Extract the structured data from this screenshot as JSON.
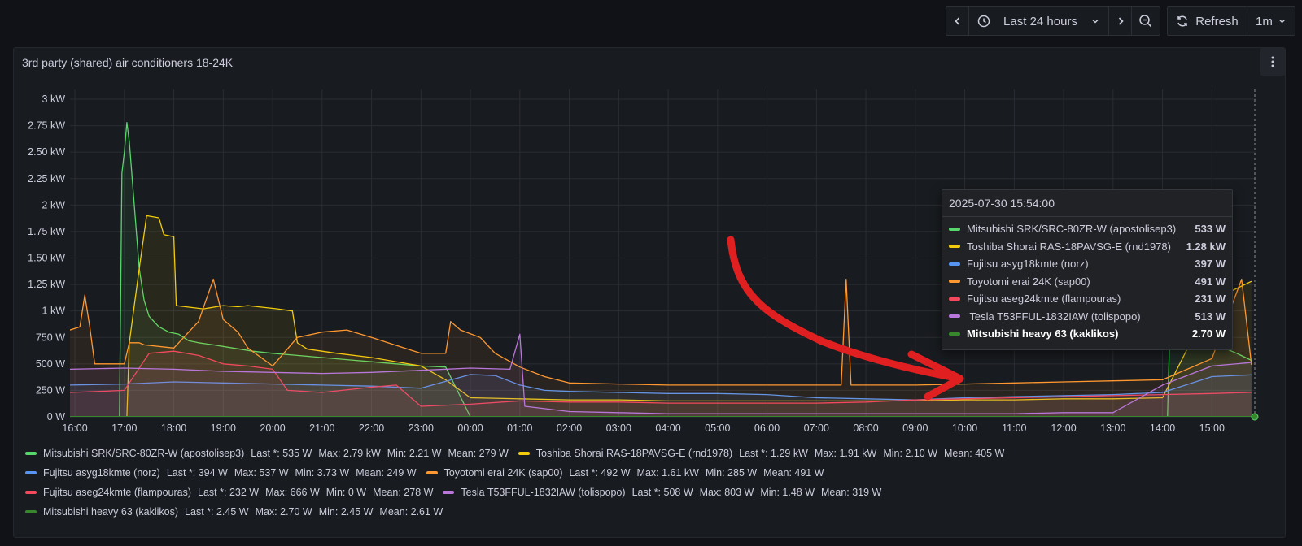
{
  "toolbar": {
    "time_range": "Last 24 hours",
    "refresh_label": "Refresh",
    "refresh_interval": "1m"
  },
  "panel": {
    "title": "3rd party (shared) air conditioners 18-24K"
  },
  "chart_data": {
    "type": "line",
    "fill": "area",
    "y_ticks": [
      "0 W",
      "250 W",
      "500 W",
      "750 W",
      "1 kW",
      "1.25 kW",
      "1.50 kW",
      "1.75 kW",
      "2 kW",
      "2.25 kW",
      "2.50 kW",
      "2.75 kW",
      "3 kW"
    ],
    "ylim": [
      0,
      3000
    ],
    "x_ticks": [
      "16:00",
      "17:00",
      "18:00",
      "19:00",
      "20:00",
      "21:00",
      "22:00",
      "23:00",
      "00:00",
      "01:00",
      "02:00",
      "03:00",
      "04:00",
      "05:00",
      "06:00",
      "07:00",
      "08:00",
      "09:00",
      "10:00",
      "11:00",
      "12:00",
      "13:00",
      "14:00",
      "15:00"
    ],
    "x_unit": "hours since 16:00",
    "xlim": [
      -0.1,
      23.9
    ],
    "grid": true,
    "series": [
      {
        "name": "Mitsubishi SRK/SRC-80ZR-W (apostolisep3)",
        "color": "#56d66b",
        "points": [
          [
            -0.1,
            0
          ],
          [
            0.9,
            0
          ],
          [
            0.95,
            2300
          ],
          [
            1.0,
            2500
          ],
          [
            1.05,
            2780
          ],
          [
            1.1,
            2600
          ],
          [
            1.2,
            2000
          ],
          [
            1.3,
            1400
          ],
          [
            1.4,
            1100
          ],
          [
            1.5,
            950
          ],
          [
            1.7,
            850
          ],
          [
            1.9,
            800
          ],
          [
            2.1,
            780
          ],
          [
            2.3,
            720
          ],
          [
            2.5,
            700
          ],
          [
            2.8,
            680
          ],
          [
            3.2,
            650
          ],
          [
            3.6,
            620
          ],
          [
            4.0,
            600
          ],
          [
            4.5,
            580
          ],
          [
            5.0,
            560
          ],
          [
            5.5,
            540
          ],
          [
            6.0,
            520
          ],
          [
            6.5,
            500
          ],
          [
            7.0,
            480
          ],
          [
            7.5,
            470
          ],
          [
            8.0,
            0
          ],
          [
            22.1,
            0
          ],
          [
            22.2,
            1700
          ],
          [
            22.25,
            2050
          ],
          [
            22.35,
            1850
          ],
          [
            22.45,
            1000
          ],
          [
            22.6,
            800
          ],
          [
            23.0,
            700
          ],
          [
            23.5,
            600
          ],
          [
            23.8,
            533
          ]
        ]
      },
      {
        "name": "Toshiba Shorai RAS-18PAVSG-E (rnd1978)",
        "color": "#f2cc0c",
        "points": [
          [
            -0.1,
            0
          ],
          [
            1.05,
            0
          ],
          [
            1.1,
            700
          ],
          [
            1.3,
            1400
          ],
          [
            1.45,
            1900
          ],
          [
            1.7,
            1880
          ],
          [
            1.8,
            1720
          ],
          [
            2.0,
            1700
          ],
          [
            2.05,
            1050
          ],
          [
            2.6,
            1020
          ],
          [
            3.0,
            1050
          ],
          [
            3.3,
            1040
          ],
          [
            3.5,
            1050
          ],
          [
            4.1,
            1020
          ],
          [
            4.4,
            1000
          ],
          [
            4.5,
            700
          ],
          [
            4.7,
            640
          ],
          [
            5.0,
            620
          ],
          [
            5.3,
            600
          ],
          [
            6.0,
            560
          ],
          [
            7.0,
            480
          ],
          [
            7.5,
            350
          ],
          [
            8.0,
            180
          ],
          [
            9.0,
            170
          ],
          [
            10.0,
            160
          ],
          [
            11.0,
            160
          ],
          [
            12.0,
            150
          ],
          [
            13.0,
            150
          ],
          [
            14.0,
            150
          ],
          [
            15.0,
            150
          ],
          [
            16.0,
            150
          ],
          [
            17.0,
            150
          ],
          [
            18.0,
            160
          ],
          [
            19.0,
            160
          ],
          [
            20.0,
            170
          ],
          [
            21.0,
            170
          ],
          [
            22.0,
            180
          ],
          [
            23.0,
            1100
          ],
          [
            23.8,
            1280
          ]
        ]
      },
      {
        "name": "Fujitsu asyg18kmte (norz)",
        "color": "#5794f2",
        "points": [
          [
            -0.1,
            300
          ],
          [
            1.0,
            310
          ],
          [
            2.0,
            330
          ],
          [
            3.0,
            320
          ],
          [
            4.0,
            310
          ],
          [
            5.0,
            300
          ],
          [
            6.0,
            290
          ],
          [
            7.0,
            270
          ],
          [
            8.0,
            400
          ],
          [
            8.5,
            390
          ],
          [
            9.0,
            300
          ],
          [
            9.5,
            250
          ],
          [
            10.0,
            240
          ],
          [
            11.0,
            230
          ],
          [
            12.0,
            220
          ],
          [
            13.0,
            220
          ],
          [
            14.0,
            210
          ],
          [
            15.0,
            180
          ],
          [
            16.0,
            170
          ],
          [
            17.0,
            160
          ],
          [
            18.0,
            180
          ],
          [
            19.0,
            190
          ],
          [
            20.0,
            200
          ],
          [
            21.0,
            210
          ],
          [
            22.0,
            230
          ],
          [
            23.0,
            380
          ],
          [
            23.8,
            397
          ]
        ]
      },
      {
        "name": "Toyotomi erai 24K (sap00)",
        "color": "#ff9830",
        "points": [
          [
            -0.1,
            820
          ],
          [
            0.1,
            850
          ],
          [
            0.2,
            1150
          ],
          [
            0.3,
            850
          ],
          [
            0.4,
            500
          ],
          [
            1.0,
            500
          ],
          [
            1.1,
            700
          ],
          [
            1.3,
            700
          ],
          [
            1.4,
            680
          ],
          [
            2.0,
            650
          ],
          [
            2.5,
            900
          ],
          [
            2.8,
            1300
          ],
          [
            3.0,
            920
          ],
          [
            3.3,
            800
          ],
          [
            3.5,
            650
          ],
          [
            4.0,
            480
          ],
          [
            4.5,
            750
          ],
          [
            5.0,
            800
          ],
          [
            5.5,
            820
          ],
          [
            6.0,
            750
          ],
          [
            7.0,
            600
          ],
          [
            7.5,
            600
          ],
          [
            7.6,
            900
          ],
          [
            7.8,
            820
          ],
          [
            8.2,
            750
          ],
          [
            8.5,
            600
          ],
          [
            9.0,
            470
          ],
          [
            9.5,
            380
          ],
          [
            10.0,
            320
          ],
          [
            11.0,
            310
          ],
          [
            12.0,
            300
          ],
          [
            13.0,
            300
          ],
          [
            14.0,
            300
          ],
          [
            15.0,
            300
          ],
          [
            15.5,
            300
          ],
          [
            15.6,
            1300
          ],
          [
            15.7,
            300
          ],
          [
            16.0,
            300
          ],
          [
            17.0,
            300
          ],
          [
            18.0,
            310
          ],
          [
            19.0,
            320
          ],
          [
            20.0,
            330
          ],
          [
            21.0,
            340
          ],
          [
            22.0,
            350
          ],
          [
            23.0,
            550
          ],
          [
            23.6,
            1300
          ],
          [
            23.8,
            491
          ]
        ]
      },
      {
        "name": "Fujitsu aseg24kmte (flampouras)",
        "color": "#f2495c",
        "points": [
          [
            -0.1,
            230
          ],
          [
            0.5,
            240
          ],
          [
            1.0,
            250
          ],
          [
            1.5,
            600
          ],
          [
            2.0,
            620
          ],
          [
            2.5,
            580
          ],
          [
            3.0,
            500
          ],
          [
            3.5,
            480
          ],
          [
            4.0,
            450
          ],
          [
            4.3,
            250
          ],
          [
            5.0,
            230
          ],
          [
            6.0,
            280
          ],
          [
            6.5,
            300
          ],
          [
            7.0,
            100
          ],
          [
            8.0,
            120
          ],
          [
            9.0,
            150
          ],
          [
            10.0,
            140
          ],
          [
            11.0,
            140
          ],
          [
            12.0,
            130
          ],
          [
            13.0,
            130
          ],
          [
            14.0,
            130
          ],
          [
            15.0,
            130
          ],
          [
            16.0,
            140
          ],
          [
            17.0,
            160
          ],
          [
            18.0,
            170
          ],
          [
            19.0,
            180
          ],
          [
            20.0,
            190
          ],
          [
            21.0,
            200
          ],
          [
            22.0,
            210
          ],
          [
            23.0,
            220
          ],
          [
            23.8,
            231
          ]
        ]
      },
      {
        "name": "Tesla T53FFUL-1832IAW (tolispopo)",
        "color": "#b877d9",
        "points": [
          [
            -0.1,
            450
          ],
          [
            1.0,
            460
          ],
          [
            2.0,
            450
          ],
          [
            3.0,
            430
          ],
          [
            4.0,
            420
          ],
          [
            5.0,
            410
          ],
          [
            6.0,
            420
          ],
          [
            7.0,
            440
          ],
          [
            8.0,
            460
          ],
          [
            8.8,
            450
          ],
          [
            9.0,
            780
          ],
          [
            9.1,
            100
          ],
          [
            10.0,
            50
          ],
          [
            11.0,
            40
          ],
          [
            12.0,
            30
          ],
          [
            13.0,
            30
          ],
          [
            14.0,
            30
          ],
          [
            15.0,
            30
          ],
          [
            16.0,
            30
          ],
          [
            17.0,
            30
          ],
          [
            18.0,
            30
          ],
          [
            19.0,
            30
          ],
          [
            20.0,
            40
          ],
          [
            21.0,
            40
          ],
          [
            22.0,
            300
          ],
          [
            23.0,
            480
          ],
          [
            23.8,
            513
          ]
        ]
      },
      {
        "name": "Mitsubishi heavy 63 (kaklikos)",
        "color": "#37872d",
        "points": [
          [
            -0.1,
            2.6
          ],
          [
            23.8,
            2.7
          ]
        ]
      }
    ]
  },
  "legend": [
    {
      "name": "Mitsubishi SRK/SRC-80ZR-W (apostolisep3)",
      "color": "#56d66b",
      "last": "Last *: 535 W",
      "max": "Max: 2.79 kW",
      "min": "Min: 2.21 W",
      "mean": "Mean: 279 W"
    },
    {
      "name": "Toshiba Shorai RAS-18PAVSG-E (rnd1978)",
      "color": "#f2cc0c",
      "last": "Last *: 1.29 kW",
      "max": "Max: 1.91 kW",
      "min": "Min: 2.10 W",
      "mean": "Mean: 405 W"
    },
    {
      "name": "Fujitsu asyg18kmte (norz)",
      "color": "#5794f2",
      "last": "Last *: 394 W",
      "max": "Max: 537 W",
      "min": "Min: 3.73 W",
      "mean": "Mean: 249 W"
    },
    {
      "name": "Toyotomi erai 24K (sap00)",
      "color": "#ff9830",
      "last": "Last *: 492 W",
      "max": "Max: 1.61 kW",
      "min": "Min: 285 W",
      "mean": "Mean: 491 W"
    },
    {
      "name": "Fujitsu aseg24kmte (flampouras)",
      "color": "#f2495c",
      "last": "Last *: 232 W",
      "max": "Max: 666 W",
      "min": "Min: 0 W",
      "mean": "Mean: 278 W"
    },
    {
      "name": "Tesla T53FFUL-1832IAW (tolispopo)",
      "color": "#b877d9",
      "last": "Last *: 508 W",
      "max": "Max: 803 W",
      "min": "Min: 1.48 W",
      "mean": "Mean: 319 W"
    },
    {
      "name": "Mitsubishi heavy 63 (kaklikos)",
      "color": "#37872d",
      "last": "Last *: 2.45 W",
      "max": "Max: 2.70 W",
      "min": "Min: 2.45 W",
      "mean": "Mean: 2.61 W"
    }
  ],
  "tooltip": {
    "time": "2025-07-30 15:54:00",
    "rows": [
      {
        "name": "Mitsubishi SRK/SRC-80ZR-W (apostolisep3)",
        "value": "533 W",
        "color": "#56d66b"
      },
      {
        "name": "Toshiba Shorai RAS-18PAVSG-E (rnd1978)",
        "value": "1.28 kW",
        "color": "#f2cc0c"
      },
      {
        "name": "Fujitsu asyg18kmte (norz)",
        "value": "397 W",
        "color": "#5794f2"
      },
      {
        "name": "Toyotomi erai 24K (sap00)",
        "value": "491 W",
        "color": "#ff9830"
      },
      {
        "name": "Fujitsu aseg24kmte (flampouras)",
        "value": "231 W",
        "color": "#f2495c"
      },
      {
        "name": " Tesla T53FFUL-1832IAW (tolispopo)",
        "value": "513 W",
        "color": "#b877d9"
      },
      {
        "name": "Mitsubishi heavy 63 (kaklikos)",
        "value": "2.70 W",
        "color": "#37872d",
        "active": true
      }
    ]
  },
  "annotation": {
    "color": "#e02020"
  }
}
